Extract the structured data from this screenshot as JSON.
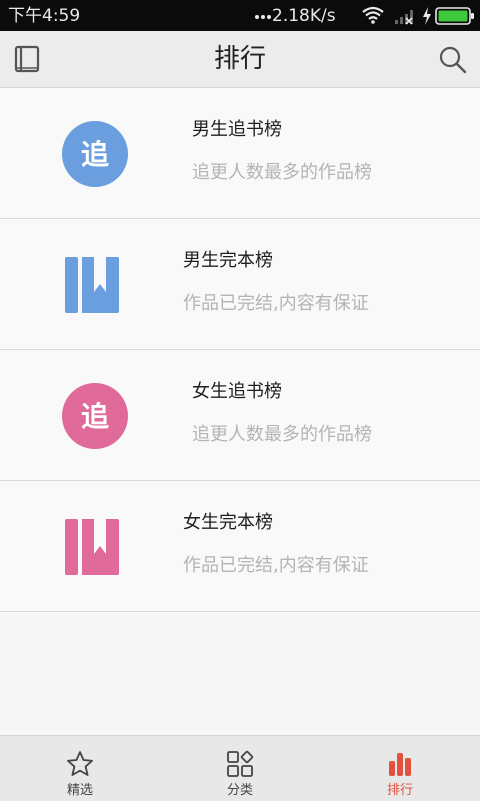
{
  "status_bar": {
    "time": "下午4:59",
    "network_speed": "2.18K/s",
    "battery_color": "#3ec93e"
  },
  "header": {
    "title": "排行"
  },
  "rankings": [
    {
      "icon": "chase-badge-icon",
      "icon_text": "追",
      "color": "#6a9ede",
      "name": "男生追书榜",
      "desc": "追更人数最多的作品榜"
    },
    {
      "icon": "book-bookmark-icon",
      "color": "#6a9ede",
      "name": "男生完本榜",
      "desc": "作品已完结,内容有保证"
    },
    {
      "icon": "chase-badge-icon",
      "icon_text": "追",
      "color": "#e06a9a",
      "name": "女生追书榜",
      "desc": "追更人数最多的作品榜"
    },
    {
      "icon": "book-bookmark-icon",
      "color": "#e06a9a",
      "name": "女生完本榜",
      "desc": "作品已完结,内容有保证"
    }
  ],
  "tabs": [
    {
      "label": "精选",
      "icon": "star-icon",
      "active": false
    },
    {
      "label": "分类",
      "icon": "category-grid-icon",
      "active": false
    },
    {
      "label": "排行",
      "icon": "ranking-bars-icon",
      "active": true
    }
  ],
  "colors": {
    "accent": "#e0533f",
    "male": "#6a9ede",
    "female": "#e06a9a"
  }
}
